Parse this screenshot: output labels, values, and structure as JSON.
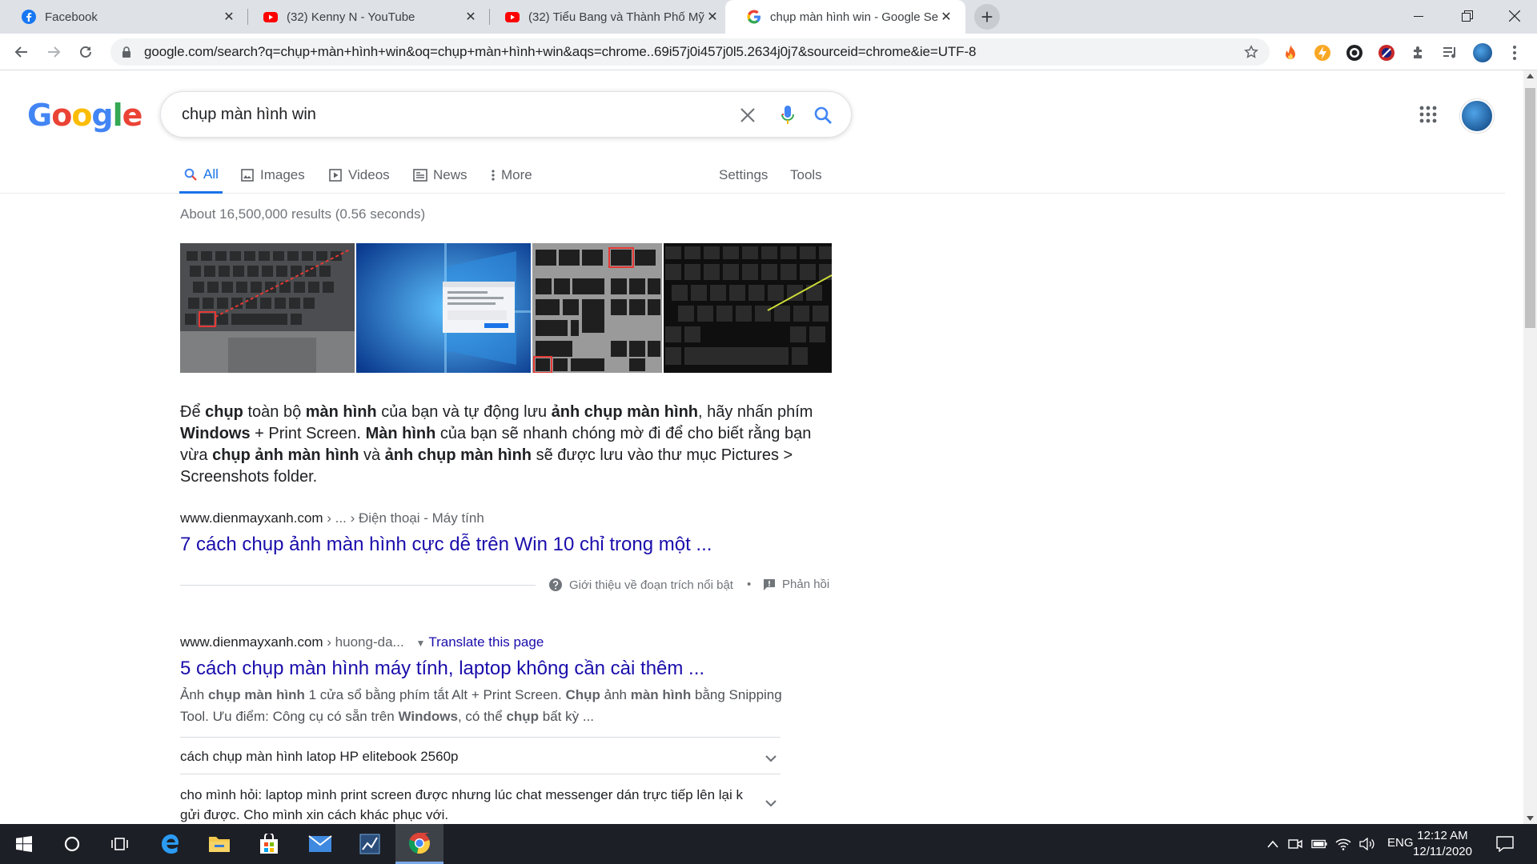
{
  "browser": {
    "tabs": [
      {
        "title": "Facebook",
        "icon": "facebook-icon"
      },
      {
        "title": "(32) Kenny N - YouTube",
        "icon": "youtube-icon"
      },
      {
        "title": "(32) Tiểu Bang và Thành Phố Mỹ",
        "icon": "youtube-icon"
      },
      {
        "title": "chụp màn hình win - Google Sea",
        "icon": "google-icon"
      }
    ],
    "url": "google.com/search?q=chụp+màn+hình+win&oq=chụp+màn+hình+win&aqs=chrome..69i57j0i457j0l5.2634j0j7&sourceid=chrome&ie=UTF-8"
  },
  "search": {
    "logo_letters": [
      "G",
      "o",
      "o",
      "g",
      "l",
      "e"
    ],
    "query": "chụp màn hình win",
    "tabs": [
      {
        "label": "All",
        "icon": "search-icon"
      },
      {
        "label": "Images",
        "icon": "image-icon"
      },
      {
        "label": "Videos",
        "icon": "video-icon"
      },
      {
        "label": "News",
        "icon": "news-icon"
      },
      {
        "label": "More",
        "icon": "more-vert-icon"
      }
    ],
    "settings_label": "Settings",
    "tools_label": "Tools",
    "stats": "About 16,500,000 results (0.56 seconds)"
  },
  "featured": {
    "snippet_html": "Để <b>chụp</b> toàn bộ <b>màn hình</b> của bạn và tự động lưu <b>ảnh chụp màn hình</b>, hãy nhấn phím <b>Windows</b> + Print Screen. <b>Màn hình</b> của bạn sẽ nhanh chóng mờ đi để cho biết rằng bạn vừa <b>chụp ảnh màn hình</b> và <b>ảnh chụp màn hình</b> sẽ được lưu vào thư mục Pictures > Screenshots folder.",
    "site": "www.dienmayxanh.com",
    "breadcrumb": " › ... › Điện thoại - Máy tính",
    "title": "7 cách chụp ảnh màn hình cực dễ trên Win 10 chỉ trong một ...",
    "about_label": "Giới thiệu về đoạn trích nổi bật",
    "dot": "•",
    "feedback_label": "Phản hồi"
  },
  "result2": {
    "site": "www.dienmayxanh.com",
    "breadcrumb": " › huong-da...",
    "translate": "Translate this page",
    "title": "5 cách chụp màn hình máy tính, laptop không cần cài thêm ...",
    "desc_html": "Ảnh <b>chụp màn hình</b> 1 cửa sổ bằng phím tắt Alt + Print Screen. <b>Chụp</b> ảnh <b>màn hình</b> bằng Snipping Tool. Ưu điểm: Công cụ có sẵn trên <b>Windows</b>, có thể <b>chụp</b> bất kỳ ...",
    "faqs": [
      "cách chụp màn hình latop HP elitebook 2560p",
      "cho mình hỏi: laptop mình print screen được nhưng lúc chat messenger dán trực tiếp lên lại k gửi được. Cho mình xin cách khác phục với."
    ]
  },
  "taskbar": {
    "lang": "ENG",
    "time": "12:12 AM",
    "date": "12/11/2020"
  },
  "colors": {
    "link": "#1a0dab",
    "accent": "#1a73e8",
    "taskbar": "#1c1f26"
  }
}
